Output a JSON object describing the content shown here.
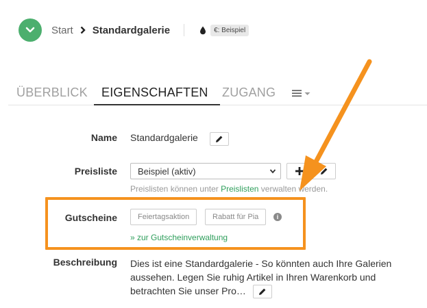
{
  "header": {
    "breadcrumb_start": "Start",
    "breadcrumb_current": "Standardgalerie",
    "badge": "€: Beispiel"
  },
  "tabs": {
    "overview": "ÜBERBLICK",
    "properties": "EIGENSCHAFTEN",
    "access": "ZUGANG"
  },
  "form": {
    "name_label": "Name",
    "name_value": "Standardgalerie",
    "pricelist_label": "Preisliste",
    "pricelist_selected": "Beispiel (aktiv)",
    "pricelist_hint_pre": "Preislisten können unter ",
    "pricelist_hint_link": "Preislisten",
    "pricelist_hint_post": " verwalten werden.",
    "coupons_label": "Gutscheine",
    "coupons": [
      "Feiertagsaktion",
      "Rabatt für Pia"
    ],
    "coupons_link": "» zur Gutscheinverwaltung",
    "description_label": "Beschreibung",
    "description_value": "Dies ist eine Standardgalerie - So könnten auch Ihre Galerien aussehen. Legen Sie ruhig Artikel in Ihren Warenkorb und betrachten Sie unser Pro…"
  },
  "colors": {
    "accent_green": "#4caf6e",
    "link_green": "#2e9e5b",
    "highlight_orange": "#f5921e"
  },
  "icons": {
    "nav": "chevron-down-icon",
    "breadcrumb_separator": "chevron-right-icon",
    "drop": "drop-icon",
    "tabs_more": "list-menu-icon",
    "edit": "pencil-icon",
    "add": "plus-icon",
    "info": "info-icon"
  }
}
